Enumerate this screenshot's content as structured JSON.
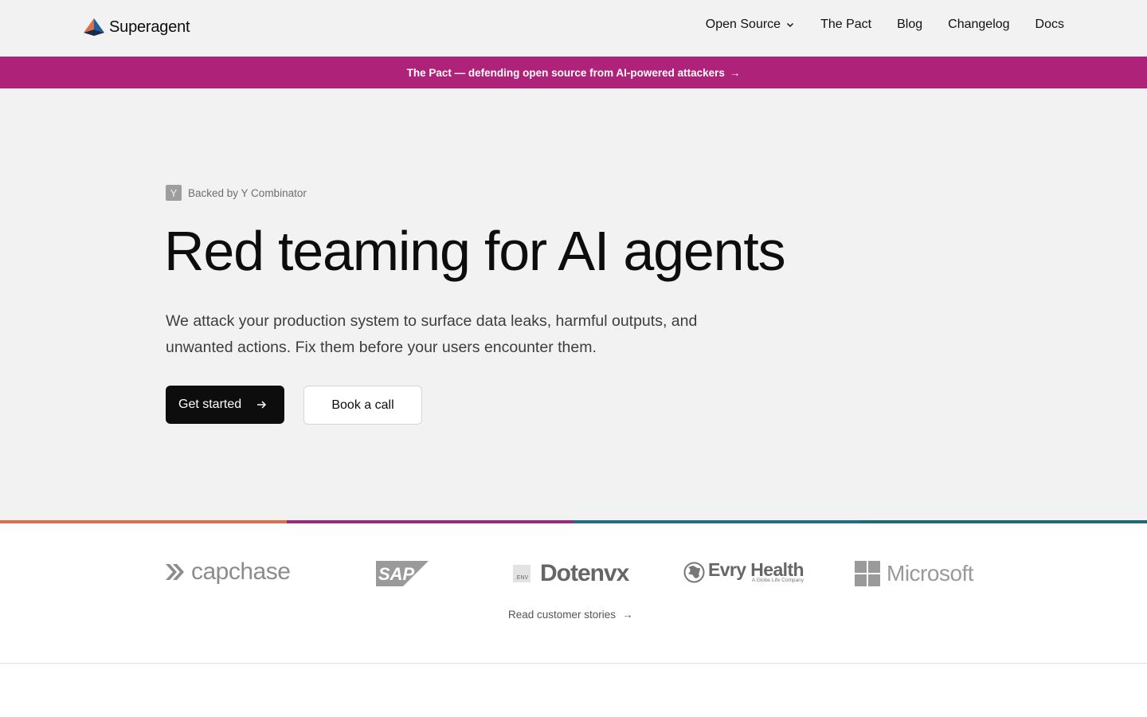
{
  "header": {
    "brand_name": "Superagent",
    "nav": {
      "open_source": "Open Source",
      "the_pact": "The Pact",
      "blog": "Blog",
      "changelog": "Changelog",
      "docs": "Docs"
    }
  },
  "announcement": {
    "text": "The Pact — defending open source from AI-powered attackers",
    "arrow": "→"
  },
  "hero": {
    "badge_letter": "Y",
    "badge_text": "Backed by Y Combinator",
    "title": "Red teaming for AI agents",
    "subtitle": "We attack your production system to surface data leaks, harmful outputs, and unwanted actions. Fix them before your users encounter them.",
    "primary_cta": "Get started",
    "secondary_cta": "Book a call"
  },
  "customers": {
    "logos": {
      "capchase": "capchase",
      "sap": "SAP",
      "dotenvx": "Dotenvx",
      "dotenvx_badge": ".ENV",
      "evry": "Evry Health",
      "evry_sub": "A Globe Life Company",
      "microsoft": "Microsoft"
    },
    "stories_link": "Read customer stories",
    "stories_arrow": "→"
  },
  "colors": {
    "announcement_bg": "#ae227a",
    "rule_segments": [
      "#d9704a",
      "#9c2a7f",
      "#1f6f8b",
      "#1b6c7a"
    ]
  }
}
